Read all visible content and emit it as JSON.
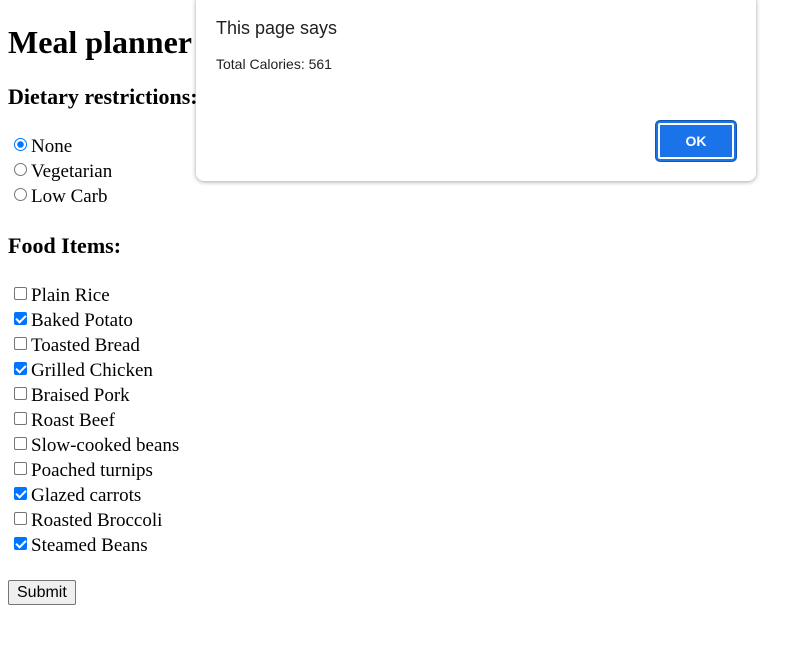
{
  "page": {
    "title": "Meal planner",
    "diet_heading": "Dietary restrictions:",
    "food_heading": "Food Items:",
    "submit_label": "Submit"
  },
  "diet_options": [
    {
      "label": "None",
      "selected": true
    },
    {
      "label": "Vegetarian",
      "selected": false
    },
    {
      "label": "Low Carb",
      "selected": false
    }
  ],
  "food_items": [
    {
      "label": "Plain Rice",
      "checked": false
    },
    {
      "label": "Baked Potato",
      "checked": true
    },
    {
      "label": "Toasted Bread",
      "checked": false
    },
    {
      "label": "Grilled Chicken",
      "checked": true
    },
    {
      "label": "Braised Pork",
      "checked": false
    },
    {
      "label": "Roast Beef",
      "checked": false
    },
    {
      "label": "Slow-cooked beans",
      "checked": false
    },
    {
      "label": "Poached turnips",
      "checked": false
    },
    {
      "label": "Glazed carrots",
      "checked": true
    },
    {
      "label": "Roasted Broccoli",
      "checked": false
    },
    {
      "label": "Steamed Beans",
      "checked": true
    }
  ],
  "alert": {
    "title": "This page says",
    "message": "Total Calories: 561",
    "ok_label": "OK"
  },
  "colors": {
    "accent": "#0075ff",
    "dialog_button": "#1a73e8"
  }
}
